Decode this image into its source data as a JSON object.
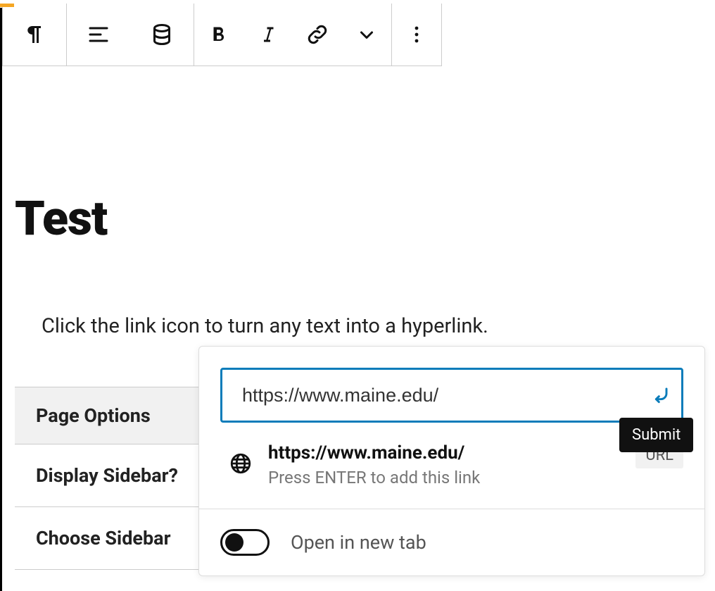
{
  "page_title": "Test",
  "paragraph_text": "Click the link icon to turn any text into a hyperlink.",
  "options": {
    "header_label": "Page Options",
    "display_sidebar_label": "Display Sidebar?",
    "choose_sidebar_label": "Choose Sidebar"
  },
  "link_popover": {
    "input_value": "https://www.maine.edu/",
    "submit_tooltip": "Submit",
    "suggestion": {
      "title": "https://www.maine.edu/",
      "hint": "Press ENTER to add this link",
      "badge": "URL"
    },
    "open_new_tab_label": "Open in new tab"
  }
}
